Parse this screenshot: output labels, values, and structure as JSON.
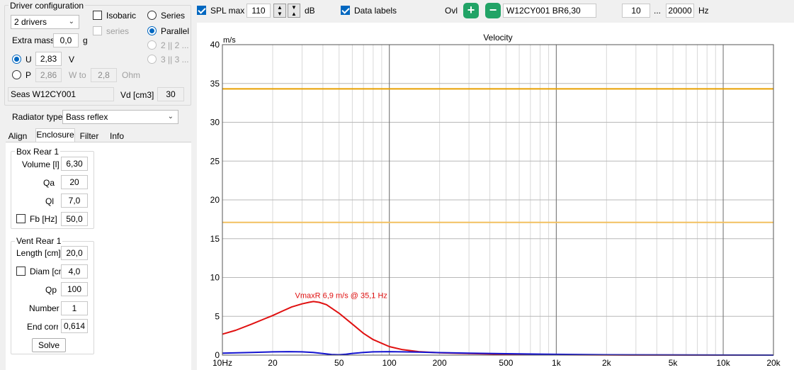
{
  "driver_config": {
    "title": "Driver configuration",
    "drivers_select": "2 drivers",
    "isobaric_label": "Isobaric",
    "series_label": "series",
    "series_radio_label": "Series",
    "parallel_radio_label": "Parallel",
    "opt_2x2": "2 || 2 ...",
    "opt_3x3": "3 || 3 ...",
    "extra_mass_label": "Extra mass",
    "extra_mass_value": "0,0",
    "extra_mass_unit": "g",
    "u_label": "U",
    "u_value": "2,83",
    "u_unit": "V",
    "p_label": "P",
    "p_value": "2,86",
    "w_to_label": "W to",
    "ohm_value": "2,8",
    "ohm_unit": "Ohm",
    "driver_name": "Seas W12CY001",
    "vd_label": "Vd [cm3]",
    "vd_value": "30"
  },
  "radiator": {
    "label": "Radiator type",
    "value": "Bass reflex"
  },
  "tabs": [
    {
      "label": "Align"
    },
    {
      "label": "Enclosure"
    },
    {
      "label": "Filter"
    },
    {
      "label": "Info"
    }
  ],
  "box": {
    "title": "Box Rear 1",
    "volume_label": "Volume [l]",
    "volume_value": "6,30",
    "qa_label": "Qa",
    "qa_value": "20",
    "ql_label": "Ql",
    "ql_value": "7,0",
    "fb_label": "Fb [Hz]",
    "fb_value": "50,0"
  },
  "vent": {
    "title": "Vent Rear 1",
    "length_label": "Length [cm]",
    "length_value": "20,0",
    "diam_label": "Diam [cm]",
    "diam_value": "4,0",
    "qp_label": "Qp",
    "qp_value": "100",
    "number_label": "Number",
    "number_value": "1",
    "endcorr_label": "End corr",
    "endcorr_value": "0,614",
    "solve_label": "Solve"
  },
  "toolbar": {
    "spl_max_label": "SPL max",
    "spl_max_value": "110",
    "db_unit": "dB",
    "data_labels_label": "Data labels",
    "ovl_label": "Ovl",
    "plus_glyph": "+",
    "minus_glyph": "−",
    "overlay_name": "W12CY001 BR6,30",
    "freq_from": "10",
    "ellipsis": "...",
    "freq_to": "20000",
    "hz_unit": "Hz"
  },
  "colors": {
    "red": "#e01010",
    "blue": "#1414d0",
    "orange": "#e8a000",
    "lightorange": "#f2c060",
    "accent": "#0067c0",
    "green": "#21a366"
  },
  "chart_data": {
    "type": "line",
    "title": "Velocity",
    "ylabel": "m/s",
    "xscale": "log",
    "xlim": [
      10,
      20000
    ],
    "ylim": [
      0,
      40
    ],
    "grid": true,
    "x_ticks": [
      {
        "v": 10,
        "label": "10Hz"
      },
      {
        "v": 20,
        "label": "20"
      },
      {
        "v": 50,
        "label": "50"
      },
      {
        "v": 100,
        "label": "100"
      },
      {
        "v": 200,
        "label": "200"
      },
      {
        "v": 500,
        "label": "500"
      },
      {
        "v": 1000,
        "label": "1k"
      },
      {
        "v": 2000,
        "label": "2k"
      },
      {
        "v": 5000,
        "label": "5k"
      },
      {
        "v": 10000,
        "label": "10k"
      },
      {
        "v": 20000,
        "label": "20k"
      }
    ],
    "y_ticks": [
      0,
      5,
      10,
      15,
      20,
      25,
      30,
      35,
      40
    ],
    "hlines": [
      {
        "y": 34.3,
        "color": "#e8a000"
      },
      {
        "y": 17.1,
        "color": "#f2c060"
      }
    ],
    "series": [
      {
        "color": "#e01010",
        "x": [
          10,
          12,
          15,
          18,
          20,
          23,
          26,
          30,
          33,
          35.1,
          38,
          42,
          50,
          60,
          70,
          80,
          100,
          120,
          150,
          200,
          300,
          500,
          1000,
          2000,
          5000,
          10000,
          20000
        ],
        "y": [
          2.7,
          3.2,
          4.0,
          4.7,
          5.1,
          5.7,
          6.2,
          6.6,
          6.8,
          6.9,
          6.8,
          6.5,
          5.4,
          4.0,
          2.8,
          2.0,
          1.1,
          0.7,
          0.45,
          0.3,
          0.2,
          0.1,
          0.05,
          0.02,
          0.01,
          0.0,
          0.0
        ]
      },
      {
        "color": "#1414d0",
        "x": [
          10,
          15,
          20,
          25,
          30,
          35,
          40,
          45,
          50,
          55,
          60,
          70,
          80,
          100,
          120,
          150,
          200,
          300,
          500,
          1000,
          2000,
          5000,
          10000,
          20000
        ],
        "y": [
          0.25,
          0.35,
          0.42,
          0.45,
          0.42,
          0.35,
          0.2,
          0.08,
          0.05,
          0.12,
          0.22,
          0.35,
          0.42,
          0.45,
          0.42,
          0.38,
          0.32,
          0.25,
          0.18,
          0.1,
          0.05,
          0.02,
          0.01,
          0.0
        ]
      }
    ],
    "annotation": {
      "text": "VmaxR 6,9 m/s @ 35,1 Hz",
      "x": 35.1,
      "y": 6.9,
      "color": "#e01010"
    }
  }
}
